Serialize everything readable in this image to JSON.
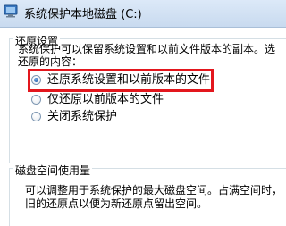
{
  "window": {
    "title": "系统保护本地磁盘 (C:)",
    "icon": "system-protection-icon"
  },
  "restore_settings": {
    "heading": "还原设置",
    "description_line1": "系统保护可以保留系统设置和以前文件版本的副本。选",
    "description_line2": "还原的内容：",
    "options": [
      {
        "label": "还原系统设置和以前版本的文件",
        "selected": true
      },
      {
        "label": "仅还原以前版本的文件",
        "selected": false
      },
      {
        "label": "关闭系统保护",
        "selected": false
      }
    ]
  },
  "disk_usage": {
    "heading": "磁盘空间使用量",
    "description_line1": "可以调整用于系统保护的最大磁盘空间。占满空间时，",
    "description_line2": "旧的还原点以便为新还原点留出空间。"
  },
  "colors": {
    "highlight": "#e3161d"
  }
}
